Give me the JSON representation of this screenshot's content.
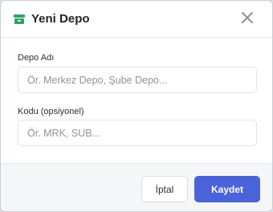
{
  "modal": {
    "title": "Yeni Depo",
    "title_icon": "archive-box-icon",
    "close_icon": "close-icon",
    "accent_color": "#2fa36b"
  },
  "form": {
    "name": {
      "label": "Depo Adı",
      "placeholder": "Ör. Merkez Depo, Şube Depo...",
      "value": ""
    },
    "code": {
      "label": "Kodu (opsiyonel)",
      "placeholder": "Ör. MRK, SUB...",
      "value": ""
    }
  },
  "footer": {
    "cancel_label": "İptal",
    "save_label": "Kaydet",
    "primary_color": "#4b63d9"
  }
}
